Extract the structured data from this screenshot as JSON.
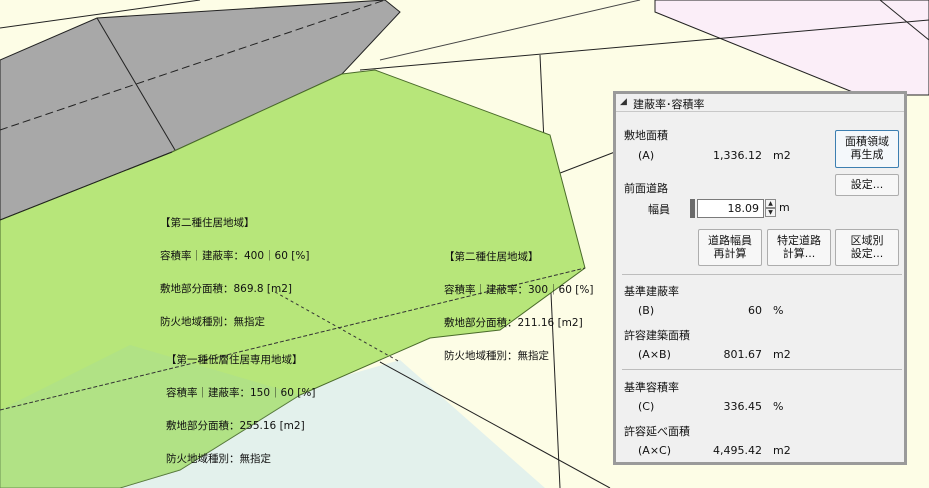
{
  "map": {
    "zones": [
      {
        "name": "【第二種住居地域】",
        "ratio": "容積率｜建蔽率：400｜60 [%]",
        "area": "敷地部分面積：869.8 [m2]",
        "fire": "防火地域種別：無指定"
      },
      {
        "name": "【第二種住居地域】",
        "ratio": "容積率｜建蔽率：300｜60 [%]",
        "area": "敷地部分面積：211.16 [m2]",
        "fire": "防火地域種別：無指定"
      },
      {
        "name": "【第一種低層住居専用地域】",
        "ratio": "容積率｜建蔽率：150｜60 [%]",
        "area": "敷地部分面積：255.16 [m2]",
        "fire": "防火地域種別：無指定"
      }
    ],
    "colors": {
      "site": "#b7e67a",
      "building": "#a8a8a8",
      "pink": "#fbeef8",
      "cyan": "#e3f1ec",
      "cream": "#fdfde6"
    }
  },
  "panel": {
    "title": "建蔽率･容積率",
    "site_area": {
      "heading": "敷地面積",
      "label": "(A)",
      "value": "1,336.12",
      "unit": "m2"
    },
    "regen_button": {
      "line1": "面積領域",
      "line2": "再生成"
    },
    "settings_button": "設定...",
    "road": {
      "heading": "前面道路",
      "width_label": "幅員",
      "width_value": "18.09",
      "unit": "m"
    },
    "road_buttons": [
      {
        "line1": "道路幅員",
        "line2": "再計算"
      },
      {
        "line1": "特定道路",
        "line2": "計算..."
      },
      {
        "line1": "区域別",
        "line2": "設定..."
      }
    ],
    "coverage": {
      "heading": "基準建蔽率",
      "label": "(B)",
      "value": "60",
      "unit": "%"
    },
    "allowed_building": {
      "heading": "許容建築面積",
      "label": "(A×B)",
      "value": "801.67",
      "unit": "m2"
    },
    "far": {
      "heading": "基準容積率",
      "label": "(C)",
      "value": "336.45",
      "unit": "%"
    },
    "allowed_floor": {
      "heading": "許容延べ面積",
      "label": "(A×C)",
      "value": "4,495.42",
      "unit": "m2"
    }
  }
}
